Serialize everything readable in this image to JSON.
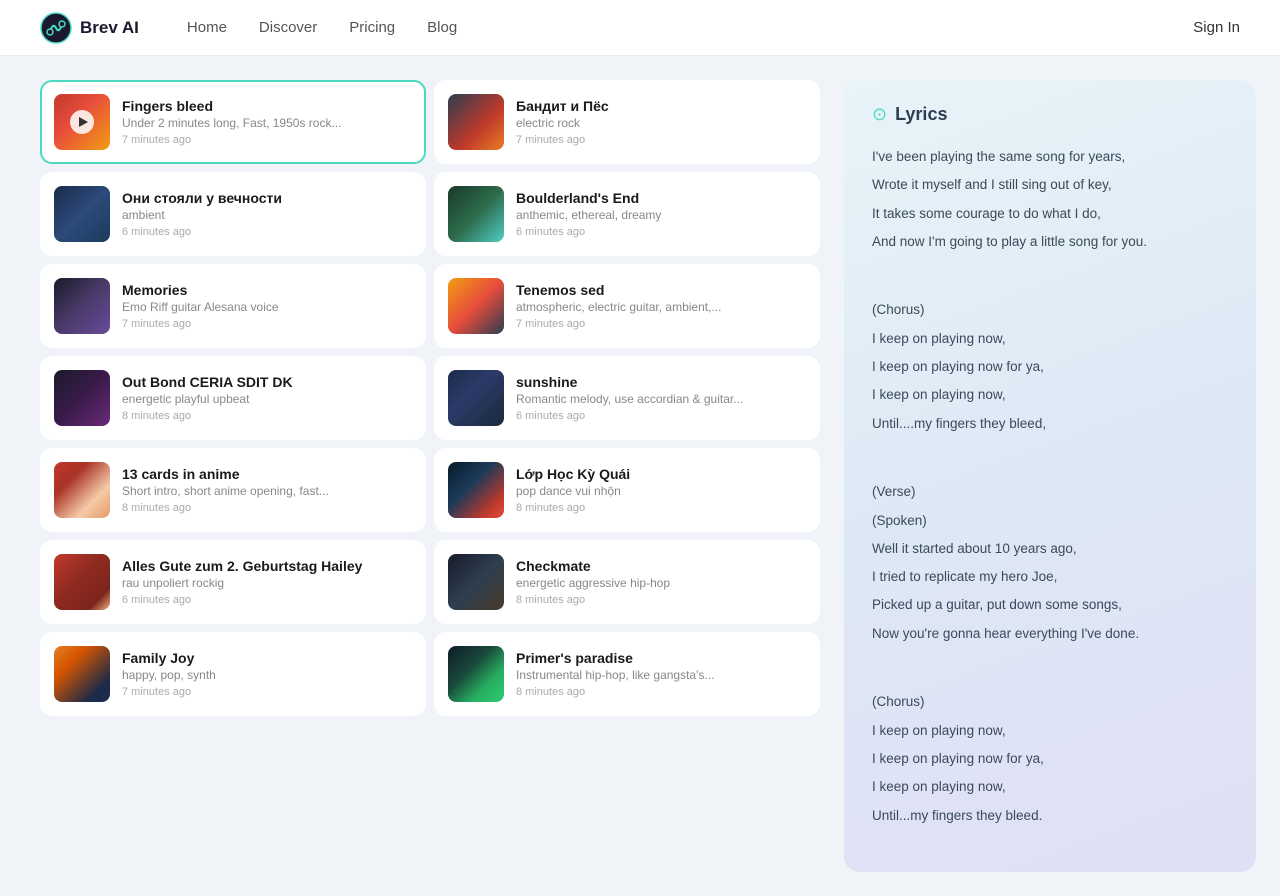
{
  "nav": {
    "logo": "Brev AI",
    "links": [
      {
        "label": "Home",
        "href": "#"
      },
      {
        "label": "Discover",
        "href": "#"
      },
      {
        "label": "Pricing",
        "href": "#"
      },
      {
        "label": "Blog",
        "href": "#"
      }
    ],
    "signIn": "Sign In"
  },
  "songs": [
    {
      "id": 1,
      "title": "Fingers bleed",
      "desc": "Under 2 minutes long, Fast, 1950s rock...",
      "time": "7 minutes ago",
      "thumb": "thumb-1",
      "active": true
    },
    {
      "id": 2,
      "title": "Бандит и Пёс",
      "desc": "electric rock",
      "time": "7 minutes ago",
      "thumb": "thumb-2",
      "active": false
    },
    {
      "id": 3,
      "title": "Они стояли у вечности",
      "desc": "ambient",
      "time": "6 minutes ago",
      "thumb": "thumb-3",
      "active": false
    },
    {
      "id": 4,
      "title": "Boulderland's End",
      "desc": "anthemic, ethereal, dreamy",
      "time": "6 minutes ago",
      "thumb": "thumb-4",
      "active": false
    },
    {
      "id": 5,
      "title": "Memories",
      "desc": "Emo Riff guitar Alesana voice",
      "time": "7 minutes ago",
      "thumb": "thumb-5",
      "active": false
    },
    {
      "id": 6,
      "title": "Tenemos sed",
      "desc": "atmospheric, electric guitar, ambient,...",
      "time": "7 minutes ago",
      "thumb": "thumb-6",
      "active": false
    },
    {
      "id": 7,
      "title": "Out Bond CERIA SDIT DK",
      "desc": "energetic playful upbeat",
      "time": "8 minutes ago",
      "thumb": "thumb-7",
      "active": false
    },
    {
      "id": 8,
      "title": "sunshine",
      "desc": "Romantic melody, use accordian & guitar...",
      "time": "6 minutes ago",
      "thumb": "thumb-8",
      "active": false
    },
    {
      "id": 9,
      "title": "13 cards in anime",
      "desc": "Short intro, short anime opening, fast...",
      "time": "8 minutes ago",
      "thumb": "thumb-9",
      "active": false
    },
    {
      "id": 10,
      "title": "Lớp Học Kỳ Quái",
      "desc": "pop dance vui nhộn",
      "time": "8 minutes ago",
      "thumb": "thumb-10",
      "active": false
    },
    {
      "id": 11,
      "title": "Alles Gute zum 2. Geburtstag Hailey",
      "desc": "rau unpoliert rockig",
      "time": "6 minutes ago",
      "thumb": "thumb-11",
      "active": false
    },
    {
      "id": 12,
      "title": "Checkmate",
      "desc": "energetic aggressive hip-hop",
      "time": "8 minutes ago",
      "thumb": "thumb-12",
      "active": false
    },
    {
      "id": 13,
      "title": "Family Joy",
      "desc": "happy, pop, synth",
      "time": "7 minutes ago",
      "thumb": "thumb-13",
      "active": false
    },
    {
      "id": 14,
      "title": "Primer's paradise",
      "desc": "Instrumental hip-hop, like gangsta's...",
      "time": "8 minutes ago",
      "thumb": "thumb-14",
      "active": false
    }
  ],
  "lyrics": {
    "title": "Lyrics",
    "lines": [
      {
        "text": "I've been playing the same song for years,",
        "type": "verse"
      },
      {
        "text": "Wrote it myself and I still sing out of key,",
        "type": "verse"
      },
      {
        "text": "It takes some courage to do what I do,",
        "type": "verse"
      },
      {
        "text": "And now I'm going to play a little song for you.",
        "type": "verse"
      },
      {
        "text": "",
        "type": "blank"
      },
      {
        "text": "(Chorus)",
        "type": "label"
      },
      {
        "text": "I keep on playing now,",
        "type": "chorus"
      },
      {
        "text": "I keep on playing now for ya,",
        "type": "chorus"
      },
      {
        "text": "I keep on playing now,",
        "type": "chorus"
      },
      {
        "text": "Until....my fingers they bleed,",
        "type": "chorus"
      },
      {
        "text": "",
        "type": "blank"
      },
      {
        "text": "(Verse)",
        "type": "label"
      },
      {
        "text": "(Spoken)",
        "type": "label"
      },
      {
        "text": "Well it started about 10 years ago,",
        "type": "verse"
      },
      {
        "text": "I tried to replicate my hero Joe,",
        "type": "verse"
      },
      {
        "text": "Picked up a guitar, put down some songs,",
        "type": "verse"
      },
      {
        "text": "Now you're gonna hear everything I've done.",
        "type": "verse"
      },
      {
        "text": "",
        "type": "blank"
      },
      {
        "text": "(Chorus)",
        "type": "label"
      },
      {
        "text": "I keep on playing now,",
        "type": "chorus"
      },
      {
        "text": "I keep on playing now for ya,",
        "type": "chorus"
      },
      {
        "text": "I keep on playing now,",
        "type": "chorus"
      },
      {
        "text": "Until...my fingers they bleed.",
        "type": "chorus"
      }
    ]
  }
}
